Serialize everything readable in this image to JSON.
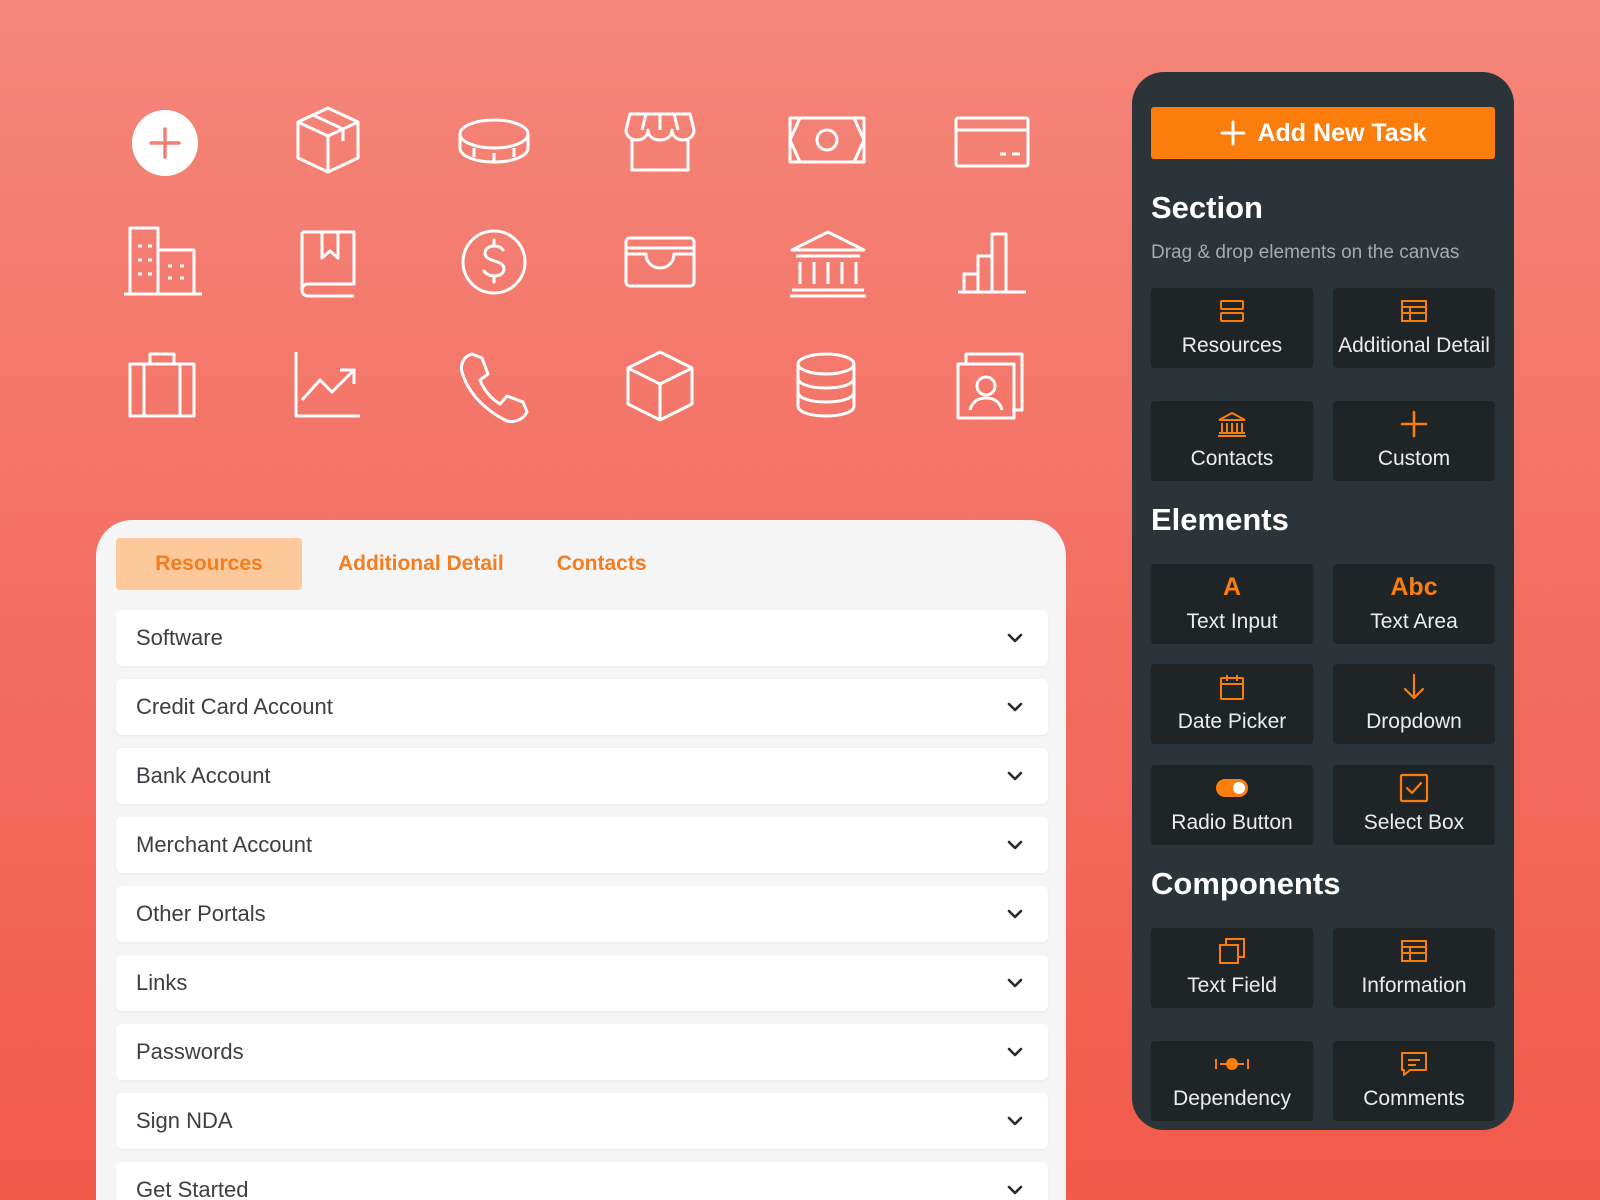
{
  "colors": {
    "accent": "#fb7d0b",
    "tab_active_bg": "#fdc89a",
    "panel_bg": "#2b3539",
    "tile_bg": "#1f2426"
  },
  "icon_grid": [
    "add-circle-icon",
    "package-icon",
    "coin-icon",
    "storefront-icon",
    "banknote-icon",
    "credit-card-icon",
    "buildings-icon",
    "bookmark-book-icon",
    "dollar-circle-icon",
    "wallet-icon",
    "bank-icon",
    "bar-chart-icon",
    "briefcase-icon",
    "line-chart-icon",
    "phone-icon",
    "cube-icon",
    "database-icon",
    "contact-card-icon"
  ],
  "tabs": [
    {
      "label": "Resources",
      "active": true
    },
    {
      "label": "Additional Detail",
      "active": false
    },
    {
      "label": "Contacts",
      "active": false
    }
  ],
  "accordion": [
    "Software",
    "Credit Card Account",
    "Bank Account",
    "Merchant Account",
    "Other Portals",
    "Links",
    "Passwords",
    "Sign NDA",
    "Get Started"
  ],
  "panel": {
    "add_button": "Add New Task",
    "section": {
      "title": "Section",
      "subtitle": "Drag & drop elements on the canvas",
      "tiles": [
        {
          "label": "Resources",
          "icon": "stack-icon"
        },
        {
          "label": "Additional Detail",
          "icon": "table-icon"
        },
        {
          "label": "Contacts",
          "icon": "bank-icon"
        },
        {
          "label": "Custom",
          "icon": "plus-icon"
        }
      ]
    },
    "elements": {
      "title": "Elements",
      "tiles": [
        {
          "label": "Text Input",
          "icon": "letter-a-icon",
          "glyph": "A"
        },
        {
          "label": "Text Area",
          "icon": "abc-icon",
          "glyph": "Abc"
        },
        {
          "label": "Date Picker",
          "icon": "calendar-icon"
        },
        {
          "label": "Dropdown",
          "icon": "arrow-down-icon"
        },
        {
          "label": "Radio Button",
          "icon": "toggle-icon"
        },
        {
          "label": "Select Box",
          "icon": "checkbox-icon"
        }
      ]
    },
    "components": {
      "title": "Components",
      "tiles": [
        {
          "label": "Text Field",
          "icon": "copy-icon"
        },
        {
          "label": "Information",
          "icon": "table-icon"
        },
        {
          "label": "Dependency",
          "icon": "dependency-icon"
        },
        {
          "label": "Comments",
          "icon": "comment-icon"
        }
      ]
    }
  }
}
